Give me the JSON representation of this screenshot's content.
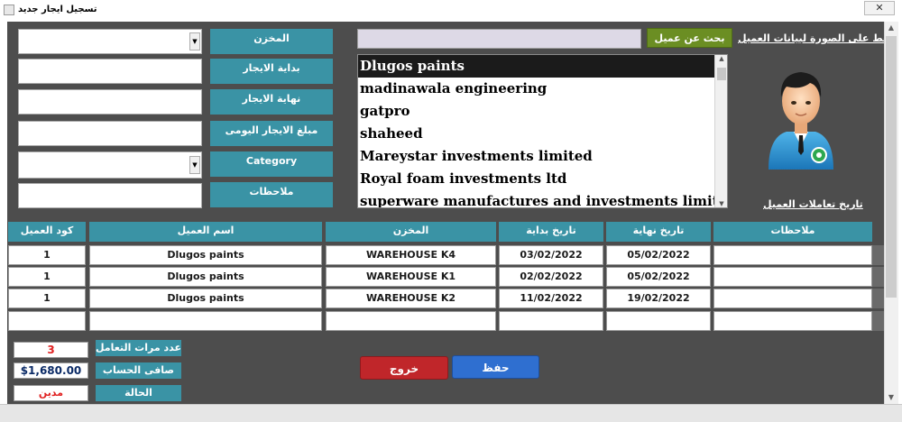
{
  "window": {
    "title": "تسجيل ايجار جديد",
    "close_glyph": "✕"
  },
  "form_fields": {
    "warehouse_label": "المخزن",
    "rent_start_label": "بداية الايجار",
    "rent_end_label": "نهاية الايجار",
    "daily_rent_label": "مبلغ الايجار اليومى",
    "category_label": "Category",
    "notes_label": "ملاحظات"
  },
  "search": {
    "button_label": "بحث عن عميل",
    "value": ""
  },
  "customer_info_link": "اضغط على الصورة لبيانات العميل",
  "customer_history_link": "تاريخ تعاملات العميل",
  "customer_list": [
    "Dlugos paints",
    "madinawala engineering",
    "gatpro",
    "shaheed",
    "Mareystar investments limited",
    "Royal foam investments ltd",
    "superware manufactures and investments limited"
  ],
  "selected_customer_index": 0,
  "grid": {
    "headers": {
      "customer_code": "كود العميل",
      "customer_name": "اسم العميل",
      "warehouse": "المخزن",
      "start_date": "تاريخ بداية",
      "end_date": "تاريخ نهاية",
      "notes": "ملاحظات"
    },
    "rows": [
      {
        "customer_code": "1",
        "customer_name": "Dlugos paints",
        "warehouse": "WAREHOUSE K4",
        "start_date": "03/02/2022",
        "end_date": "05/02/2022",
        "notes": ""
      },
      {
        "customer_code": "1",
        "customer_name": "Dlugos paints",
        "warehouse": "WAREHOUSE K1",
        "start_date": "02/02/2022",
        "end_date": "05/02/2022",
        "notes": ""
      },
      {
        "customer_code": "1",
        "customer_name": "Dlugos paints",
        "warehouse": "WAREHOUSE K2",
        "start_date": "11/02/2022",
        "end_date": "19/02/2022",
        "notes": ""
      },
      {
        "customer_code": "",
        "customer_name": "",
        "warehouse": "",
        "start_date": "",
        "end_date": "",
        "notes": ""
      }
    ]
  },
  "stats": {
    "transactions_label": "عدد مرات التعامل",
    "transactions_value": "3",
    "net_balance_label": "صافى الحساب",
    "net_balance_value": "$1,680.00",
    "status_label": "الحالة",
    "status_value": "مدين"
  },
  "buttons": {
    "exit_label": "خروج",
    "save_label": "حفظ"
  },
  "colors": {
    "form_background": "#4d4d4d",
    "label_teal": "#3a93a5",
    "search_green": "#6b8e23",
    "exit_red": "#c0262a",
    "save_blue": "#2f6fd0",
    "alert_red": "#e02020"
  },
  "icons": {
    "avatar": "customer-avatar-icon"
  }
}
